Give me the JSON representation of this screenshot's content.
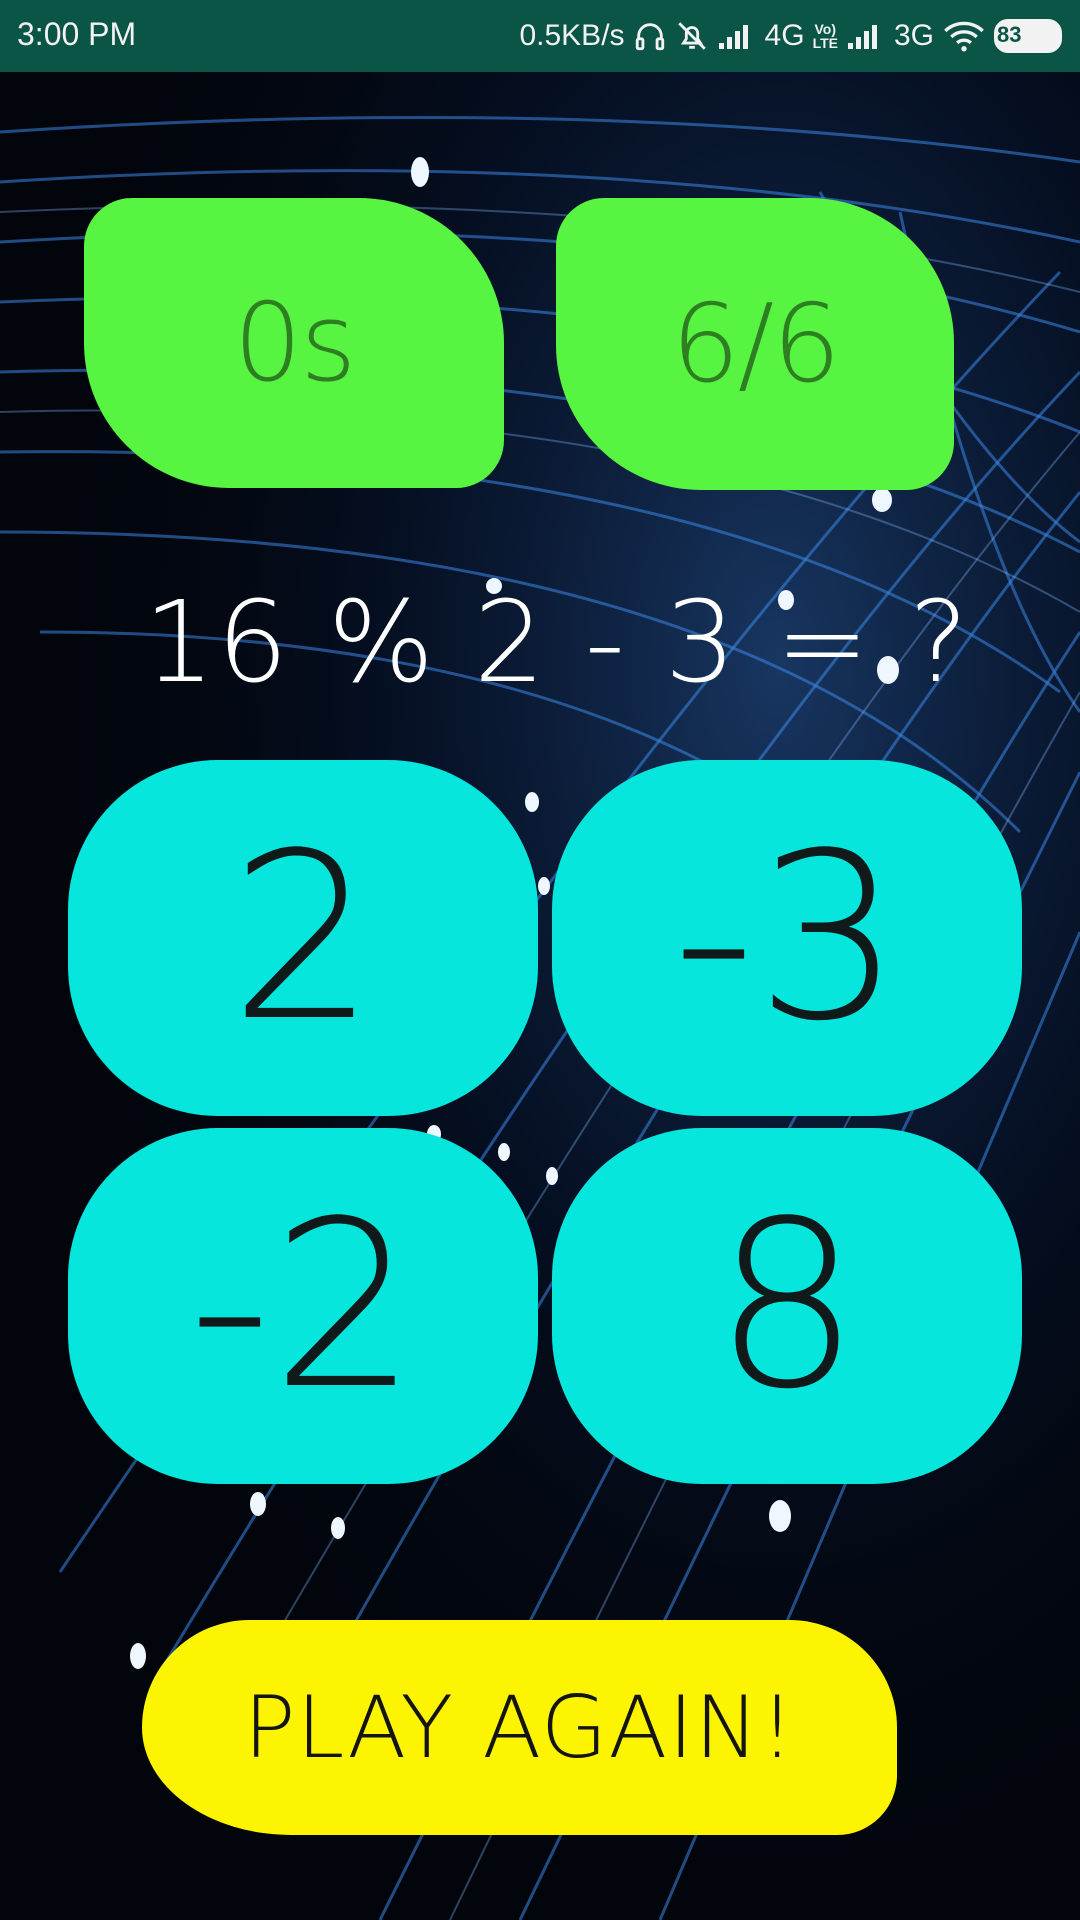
{
  "status_bar": {
    "time": "3:00 PM",
    "net_speed": "0.5KB/s",
    "network_1": "4G",
    "volte_top": "Vo)",
    "volte_bottom": "LTE",
    "network_2": "3G",
    "battery": "83"
  },
  "game": {
    "timer": "0s",
    "score": "6/6",
    "question": "16 % 2 - 3 = ?",
    "answers": [
      "2",
      "-3",
      "-2",
      "8"
    ],
    "play_again_label": "PLAY AGAIN!"
  },
  "colors": {
    "status_bar": "#0b5547",
    "stat_pill": "#58f442",
    "answer_button": "#07e6dd",
    "play_again": "#fdf402",
    "background": "#02050c"
  }
}
